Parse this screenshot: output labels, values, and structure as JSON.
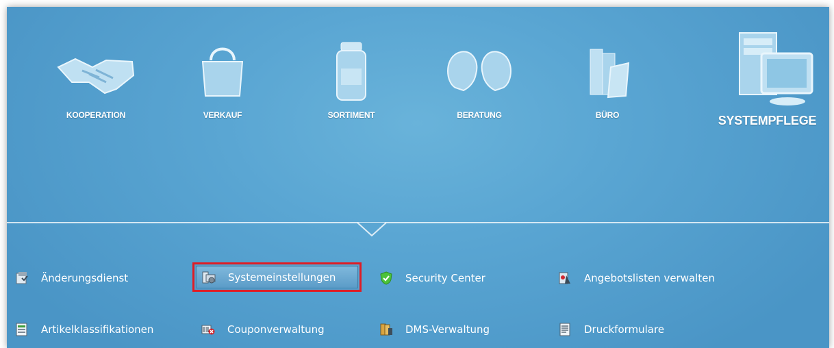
{
  "nav": {
    "items": [
      {
        "label": "KOOPERATION",
        "icon": "handshake-icon"
      },
      {
        "label": "VERKAUF",
        "icon": "shopping-bag-icon"
      },
      {
        "label": "SORTIMENT",
        "icon": "medicine-jar-icon"
      },
      {
        "label": "BERATUNG",
        "icon": "consultation-heads-icon"
      },
      {
        "label": "BÜRO",
        "icon": "office-binders-icon"
      },
      {
        "label": "SYSTEMPFLEGE",
        "icon": "computer-system-icon",
        "active": true
      }
    ]
  },
  "functions": {
    "row1": [
      {
        "label": "Änderungsdienst",
        "icon": "update-service-icon"
      },
      {
        "label": "Systemeinstellungen",
        "icon": "system-settings-icon",
        "selected": true
      },
      {
        "label": "Security Center",
        "icon": "security-shield-icon"
      },
      {
        "label": "Angebotslisten verwalten",
        "icon": "offer-lists-icon"
      }
    ],
    "row2": [
      {
        "label": "Artikelklassifikationen",
        "icon": "article-classification-icon"
      },
      {
        "label": "Couponverwaltung",
        "icon": "coupon-icon"
      },
      {
        "label": "DMS-Verwaltung",
        "icon": "dms-icon"
      },
      {
        "label": "Druckformulare",
        "icon": "print-forms-icon"
      }
    ]
  },
  "colors": {
    "background": "#5aa6d3",
    "highlight": "#e01c24",
    "text": "#ffffff"
  }
}
